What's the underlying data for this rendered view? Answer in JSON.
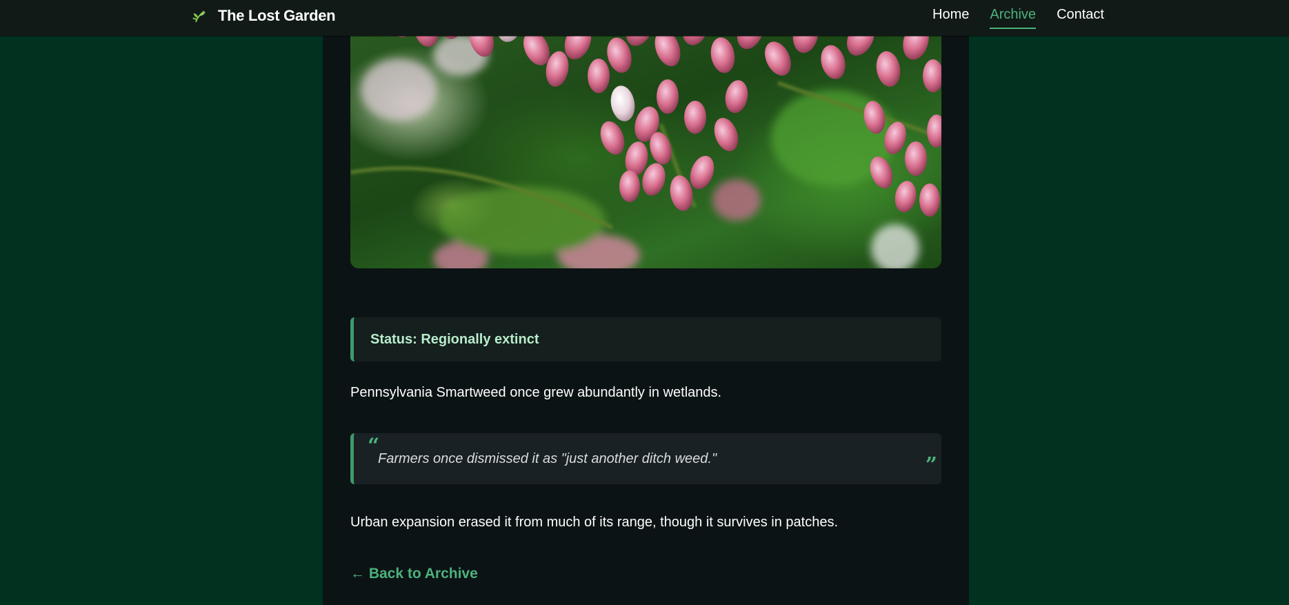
{
  "brand": {
    "title": "The Lost Garden",
    "icon": "sprout-icon"
  },
  "nav": {
    "links": [
      {
        "label": "Home",
        "active": false
      },
      {
        "label": "Archive",
        "active": true
      },
      {
        "label": "Contact",
        "active": false
      }
    ]
  },
  "hero": {
    "subject": "pink smartweed flower clusters"
  },
  "status": {
    "text": "Status: Regionally extinct"
  },
  "content": {
    "intro": "Pennsylvania Smartweed once grew abundantly in wetlands.",
    "quote": "Farmers once dismissed it as \"just another ditch weed.\"",
    "outro": "Urban expansion erased it from much of its range, though it survives in patches."
  },
  "back_link": {
    "label": "← Back to Archive"
  },
  "colors": {
    "page_background": "#00321f",
    "panel_background": "#0c1315",
    "accent": "#4cb27c",
    "status_text": "#b9eccb"
  }
}
